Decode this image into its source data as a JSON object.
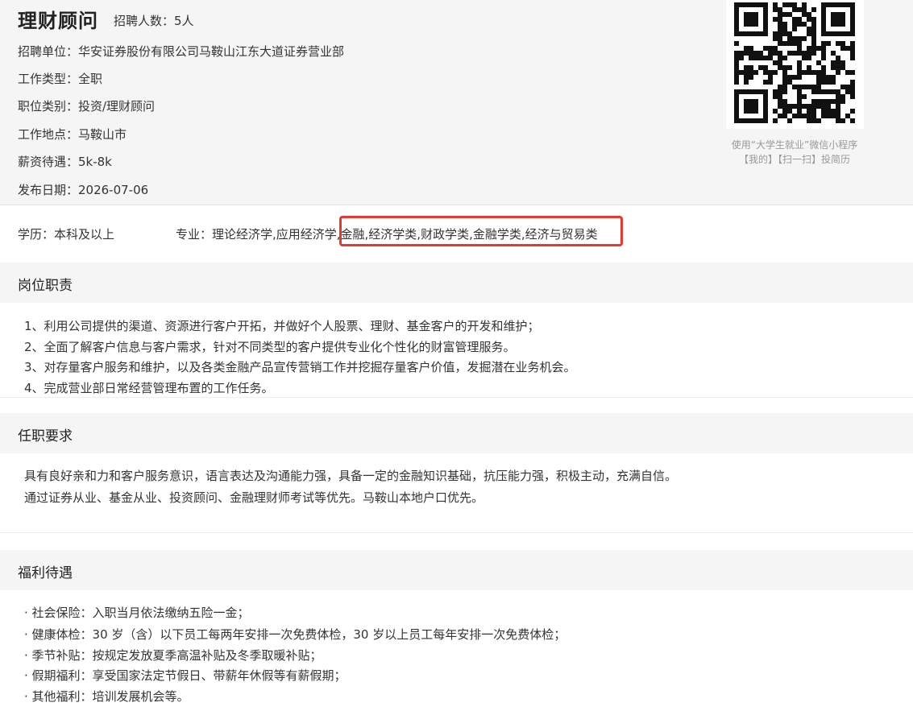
{
  "job": {
    "title": "理财顾问",
    "headcount": "招聘人数：5人",
    "info": [
      "招聘单位：华安证券股份有限公司马鞍山江东大道证券营业部",
      "工作类型：全职",
      "职位类别：投资/理财顾问",
      "工作地点：马鞍山市",
      "薪资待遇：5k-8k",
      "发布日期：2026-07-06"
    ]
  },
  "qr": {
    "caption_line1": "使用“大学生就业”微信小程序",
    "caption_line2": "【我的】【扫一扫】投简历"
  },
  "requirements_row": {
    "education": "学历：本科及以上",
    "major": "专业：理论经济学,应用经济学,金融,经济学类,财政学类,金融学类,经济与贸易类"
  },
  "duties": {
    "title": "岗位职责",
    "items": [
      "1、利用公司提供的渠道、资源进行客户开拓，并做好个人股票、理财、基金客户的开发和维护；",
      "2、全面了解客户信息与客户需求，针对不同类型的客户提供专业化个性化的财富管理服务。",
      "3、对存量客户服务和维护，以及各类金融产品宣传营销工作并挖掘存量客户价值，发掘潜在业务机会。",
      "4、完成营业部日常经营管理布置的工作任务。"
    ]
  },
  "qualifications": {
    "title": "任职要求",
    "items": [
      "具有良好亲和力和客户服务意识，语言表达及沟通能力强，具备一定的金融知识基础，抗压能力强，积极主动，充满自信。",
      "通过证券从业、基金从业、投资顾问、金融理财师考试等优先。马鞍山本地户口优先。"
    ]
  },
  "benefits": {
    "title": "福利待遇",
    "items": [
      "· 社会保险：入职当月依法缴纳五险一金；",
      "· 健康体检：30 岁（含）以下员工每两年安排一次免费体检，30 岁以上员工每年安排一次免费体检；",
      "· 季节补贴：按规定发放夏季高温补贴及冬季取暖补贴；",
      "· 假期福利：享受国家法定节假日、带薪年休假等有薪假期；",
      "· 其他福利：培训发展机会等。"
    ]
  },
  "colors": {
    "highlight_border": "#e53935",
    "header_bg": "#f5f5f5"
  }
}
